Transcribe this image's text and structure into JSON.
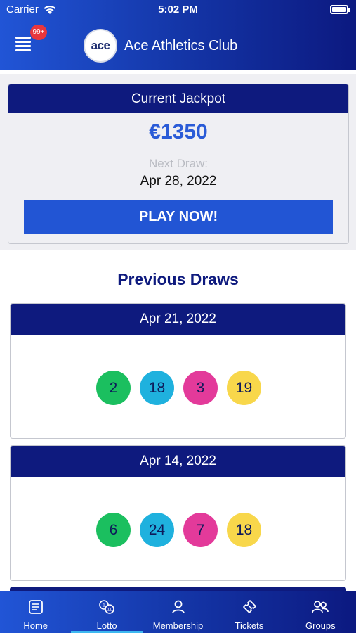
{
  "status_bar": {
    "carrier": "Carrier",
    "time": "5:02 PM"
  },
  "header": {
    "badge": "99+",
    "logo_text": "ace",
    "club_name": "Ace Athletics Club"
  },
  "jackpot": {
    "title": "Current Jackpot",
    "amount": "€1350",
    "next_draw_label": "Next Draw:",
    "next_draw_date": "Apr 28, 2022",
    "play_button": "PLAY NOW!"
  },
  "previous_draws": {
    "title": "Previous Draws",
    "draws": [
      {
        "date": "Apr 21, 2022",
        "numbers": [
          "2",
          "18",
          "3",
          "19"
        ]
      },
      {
        "date": "Apr 14, 2022",
        "numbers": [
          "6",
          "24",
          "7",
          "18"
        ]
      }
    ]
  },
  "colors": {
    "header_dark": "#0e1a7e",
    "accent": "#2255d4",
    "ball_green": "#1bbf5f",
    "ball_blue": "#1fb1de",
    "ball_pink": "#e33a9a",
    "ball_yellow": "#f8d74b"
  },
  "tabbar": {
    "active": "Lotto",
    "tabs": [
      {
        "label": "Home",
        "icon": "news-icon"
      },
      {
        "label": "Lotto",
        "icon": "lotto-balls-icon"
      },
      {
        "label": "Membership",
        "icon": "person-icon"
      },
      {
        "label": "Tickets",
        "icon": "ticket-icon"
      },
      {
        "label": "Groups",
        "icon": "group-icon"
      }
    ]
  }
}
